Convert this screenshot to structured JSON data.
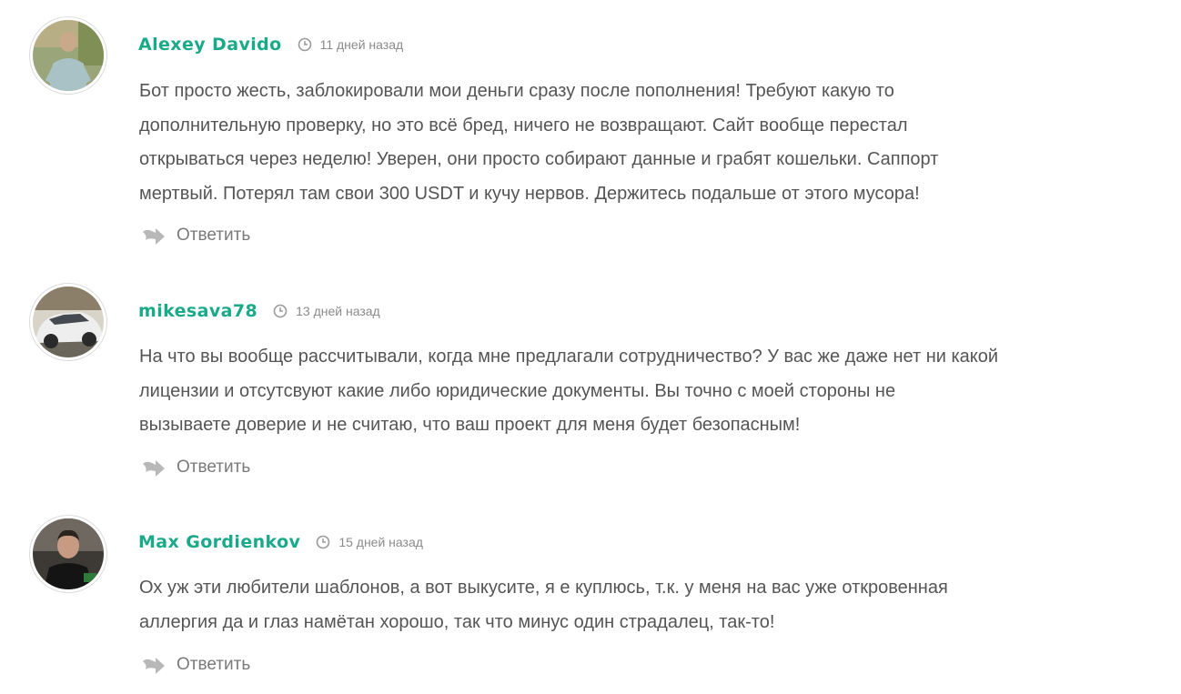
{
  "comments": [
    {
      "author": "Alexey Davido",
      "date": "11 дней назад",
      "lines": [
        "Бот просто жесть, заблокировали мои деньги сразу после пополнения! Требуют какую то",
        "дополнительную проверку, но это всё бред, ничего не возвращают. Сайт вообще перестал",
        "открываться через неделю! Уверен, они просто собирают данные и грабят кошельки. Саппорт",
        "мертвый. Потерял там свои 300 USDT и кучу нервов. Держитесь подальше от этого мусора!"
      ],
      "reply_label": "Ответить"
    },
    {
      "author": "mikesava78",
      "date": "13 дней назад",
      "lines": [
        "На что вы вообще рассчитывали, когда мне предлагали сотрудничество? У вас же даже нет ни какой",
        "лицензии и отсутсвуют какие либо юридические документы. Вы точно с моей стороны не",
        "вызываете доверие и не считаю, что ваш проект для меня будет безопасным!"
      ],
      "reply_label": "Ответить"
    },
    {
      "author": "Max Gordienkov",
      "date": "15 дней назад",
      "lines": [
        "Ох уж эти любители шаблонов, а вот выкусите, я е куплюсь, т.к. у меня на вас уже откровенная",
        "аллергия да и глаз намётан хорошо, так что минус один страдалец, так-то!"
      ],
      "reply_label": "Ответить"
    }
  ],
  "colors": {
    "author": "#1aaa8a",
    "text": "#555555",
    "meta": "#8a8a8a"
  },
  "icons": {
    "time": "clock-icon",
    "reply": "reply-arrow-icon"
  }
}
